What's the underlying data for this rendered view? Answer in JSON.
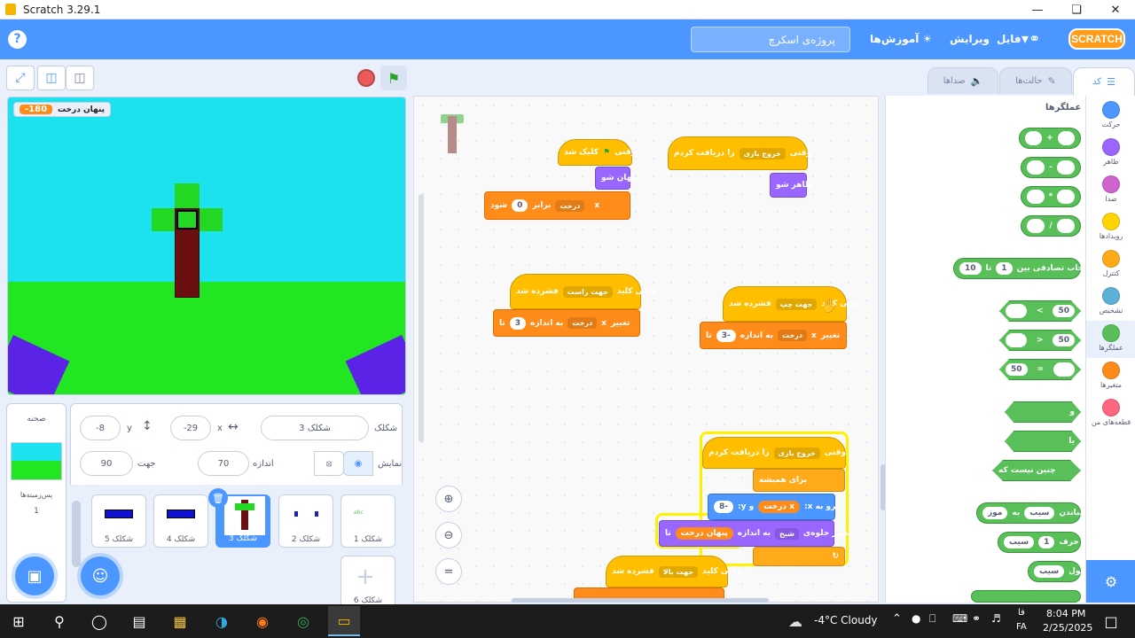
{
  "window": {
    "title": "Scratch 3.29.1"
  },
  "menubar": {
    "project_name": "پروژه‌ی اسکرچ",
    "tutorials": "آموزش‌ها",
    "edit": "ویرایش",
    "file": "فایل",
    "logo_text": "SCRATCH",
    "help": "?"
  },
  "tabs": {
    "code": "کد",
    "costumes": "حالت‌ها",
    "sounds": "صداها"
  },
  "stage": {
    "monitor_label": "پنهان درخت",
    "monitor_value": "-180"
  },
  "sprite_info": {
    "sprite_label": "شکلک",
    "sprite_name": "شکلک 3",
    "x_label": "x",
    "x_value": "-29",
    "y_label": "y",
    "y_value": "-8",
    "show_label": "نمایش",
    "size_label": "اندازه",
    "size_value": "70",
    "direction_label": "جهت",
    "direction_value": "90"
  },
  "stage_panel": {
    "title": "صحنه",
    "backdrops_label": "پس‌زمینه‌ها",
    "backdrops_count": "1"
  },
  "sprites": [
    {
      "name": "شکلک 1"
    },
    {
      "name": "شکلک 2"
    },
    {
      "name": "شکلک 3"
    },
    {
      "name": "شکلک 4"
    },
    {
      "name": "شکلک 5"
    },
    {
      "name": "شکلک 6"
    }
  ],
  "code": {
    "s1": {
      "hat": "وقتی",
      "flag_word": "کلیک شد",
      "b1": "پنهان شو",
      "b2a": "درخت",
      "b2b": "برابر",
      "b2c": "0",
      "b2d": "شود",
      "b2var": "x"
    },
    "s2": {
      "hat": "وقتی",
      "dd": "خروج بازی",
      "hat2": "را دریافت کردم",
      "b1": "ظاهر شو"
    },
    "s3": {
      "hat": "وقتی کلید",
      "dd": "جهت راست",
      "hat2": "فشرده شد",
      "b1": "تغییر",
      "b1dd": "درخت",
      "b1b": "به اندازه",
      "b1v": "3",
      "b1c": "تا",
      "var": "x"
    },
    "s4": {
      "hat": "وقتی کلید",
      "dd": "جهت چپ",
      "hat2": "فشرده شد",
      "b1": "تغییر",
      "b1dd": "درخت",
      "b1b": "به اندازه",
      "b1v": "-3",
      "b1c": "تا",
      "var": "x"
    },
    "s5": {
      "hat": "وقتی",
      "dd": "خروج بازی",
      "hat2": "را دریافت کردم",
      "loop": "برای همیشه",
      "go": "برو به x:",
      "go_var": "درخت",
      "go_y": "و y:",
      "go_yv": "-8",
      "chg": "تغییر جلوه‌ی",
      "chg_dd": "شبح",
      "chg_b": "به اندازه",
      "chg_v": "پنهان درخت",
      "chg_c": "تا",
      "var": "x"
    },
    "s6": {
      "hat": "وقتی کلید",
      "dd": "جهت بالا",
      "hat2": "فشرده شد"
    }
  },
  "palette": {
    "section": "عملگرها",
    "add": "+",
    "sub": "-",
    "mul": "*",
    "div": "/",
    "random": "انتخاب تصادفی بین",
    "random_a": "1",
    "random_to": "تا",
    "random_b": "10",
    "gt_v": "50",
    "gt": ">",
    "lt_v": "50",
    "lt": "<",
    "eq_v": "50",
    "eq": "=",
    "and": "و",
    "or": "یا",
    "not": "چنین نیست که",
    "join": "چسباندن",
    "join_a": "سیب",
    "join_b": "به",
    "join_c": "موز",
    "letter": "حرف",
    "letter_n": "1",
    "letter_of": "سیب",
    "length": "طول",
    "length_of": "سیب"
  },
  "categories": [
    {
      "name": "حرکت",
      "color": "#4c97ff"
    },
    {
      "name": "ظاهر",
      "color": "#9966ff"
    },
    {
      "name": "صدا",
      "color": "#cf63cf"
    },
    {
      "name": "رویدادها",
      "color": "#ffd500"
    },
    {
      "name": "کنترل",
      "color": "#ffab19"
    },
    {
      "name": "تشخیص",
      "color": "#5cb1d6"
    },
    {
      "name": "عملگرها",
      "color": "#59c059"
    },
    {
      "name": "متغیرها",
      "color": "#ff8c1a"
    },
    {
      "name": "قطعه‌های من",
      "color": "#ff6680"
    }
  ],
  "taskbar": {
    "weather": "-4°C  Cloudy",
    "lang1": "فا",
    "lang2": "FA",
    "time": "8:04 PM",
    "date": "2/25/2025"
  }
}
